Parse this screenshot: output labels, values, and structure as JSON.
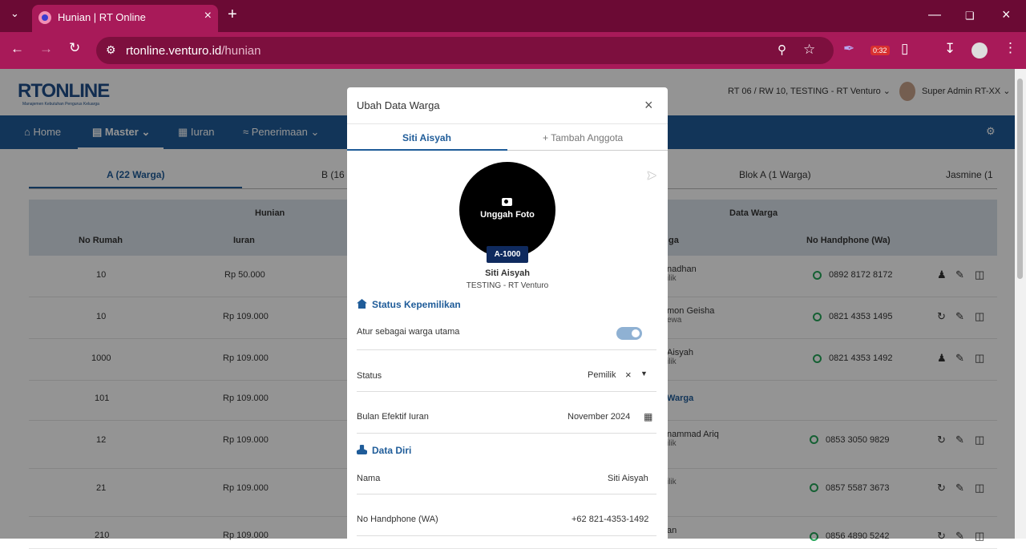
{
  "browser": {
    "tab_title": "Hunian | RT Online",
    "url_host": "rtonline.venturo.id",
    "url_path": "/hunian",
    "ext_badge": "0:32"
  },
  "app": {
    "logo_main": "RTONLINE",
    "logo_tag": "Manajemen Kebutuhan Pengurus Keluarga",
    "location": "RT 06 / RW 10, TESTING - RT Venturo",
    "user": "Super Admin RT-XX",
    "nav": [
      "Home",
      "Master",
      "Iuran",
      "Penerimaan"
    ],
    "subtabs": [
      "A (22 Warga)",
      "B (16 W",
      "Blok A (1 Warga)",
      "Jasmine (1"
    ],
    "table": {
      "group_left": "Hunian",
      "group_right": "Data Warga",
      "col_no": "No Rumah",
      "col_iuran": "Iuran",
      "col_warga": "ga",
      "col_phone": "No Handphone (Wa)",
      "rows": [
        {
          "no": "10",
          "iuran": "Rp 50.000",
          "name": "nadhan",
          "role": "ilik",
          "phone": "0892 8172 8172"
        },
        {
          "no": "10",
          "iuran": "Rp 109.000",
          "name": "mon Geisha",
          "role": "ewa",
          "phone": "0821 4353 1495"
        },
        {
          "no": "1000",
          "iuran": "Rp 109.000",
          "name": "Aisyah",
          "role": "ilik",
          "phone": "0821 4353 1492"
        },
        {
          "no": "101",
          "iuran": "Rp 109.000",
          "name": "Warga",
          "role": "",
          "phone": ""
        },
        {
          "no": "12",
          "iuran": "Rp 109.000",
          "name": "nammad Ariq",
          "role": "ilik",
          "phone": "0853 3050 9829"
        },
        {
          "no": "21",
          "iuran": "Rp 109.000",
          "name": "",
          "role": "ilik",
          "phone": "0857 5587 3673"
        },
        {
          "no": "210",
          "iuran": "Rp 109.000",
          "name": "an",
          "role": "",
          "phone": "0856 4890 5242"
        }
      ]
    }
  },
  "modal": {
    "title": "Ubah Data Warga",
    "tab_active": "Siti Aisyah",
    "tab_add": "+ Tambah Anggota",
    "upload_label": "Unggah Foto",
    "house_badge": "A-1000",
    "name": "Siti Aisyah",
    "org": "TESTING - RT Venturo",
    "sec_ownership": "Status Kepemilikan",
    "primary_label": "Atur sebagai warga utama",
    "status_label": "Status",
    "status_value": "Pemilik",
    "month_label": "Bulan Efektif Iuran",
    "month_value": "November 2024",
    "sec_personal": "Data Diri",
    "name_label": "Nama",
    "name_value": "Siti Aisyah",
    "phone_label": "No Handphone (WA)",
    "phone_value": "+62 821-4353-1492"
  }
}
